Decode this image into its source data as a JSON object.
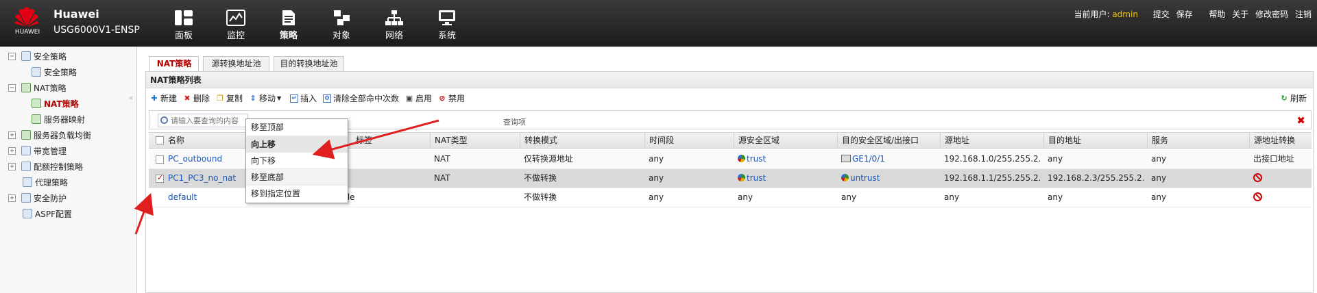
{
  "header": {
    "logo_text": "HUAWEI",
    "brand": "Huawei",
    "model": "USG6000V1-ENSP",
    "nav": [
      {
        "label": "面板",
        "icon": "dashboard-icon"
      },
      {
        "label": "监控",
        "icon": "monitor-icon"
      },
      {
        "label": "策略",
        "icon": "policy-icon"
      },
      {
        "label": "对象",
        "icon": "object-icon"
      },
      {
        "label": "网络",
        "icon": "network-icon"
      },
      {
        "label": "系统",
        "icon": "system-icon"
      }
    ],
    "user_label": "当前用户:",
    "user_name": "admin",
    "actions": [
      "提交",
      "保存",
      "帮助",
      "关于",
      "修改密码",
      "注销"
    ]
  },
  "sidebar": {
    "items": [
      {
        "label": "安全策略",
        "toggle": "−"
      },
      {
        "label": "安全策略"
      },
      {
        "label": "NAT策略",
        "toggle": "−"
      },
      {
        "label": "NAT策略"
      },
      {
        "label": "服务器映射"
      },
      {
        "label": "服务器负载均衡",
        "toggle": "+"
      },
      {
        "label": "带宽管理",
        "toggle": "+"
      },
      {
        "label": "配额控制策略",
        "toggle": "+"
      },
      {
        "label": "代理策略"
      },
      {
        "label": "安全防护",
        "toggle": "+"
      },
      {
        "label": "ASPF配置"
      }
    ],
    "collapse": "«"
  },
  "tabs": [
    "NAT策略",
    "源转换地址池",
    "目的转换地址池"
  ],
  "panel_title": "NAT策略列表",
  "toolbar": {
    "new": "新建",
    "delete": "删除",
    "copy": "复制",
    "move": "移动",
    "insert": "插入",
    "clear_hits": "清除全部命中次数",
    "enable": "启用",
    "disable": "禁用",
    "refresh": "刷新"
  },
  "search": {
    "placeholder": "请输入要查询的内容",
    "query": "查询项"
  },
  "table": {
    "columns": [
      "名称",
      "标签",
      "NAT类型",
      "转换模式",
      "时间段",
      "源安全区域",
      "目的安全区域/出接口",
      "源地址",
      "目的地址",
      "服务",
      "源地址转换"
    ],
    "rows": [
      {
        "name": "PC_outbound",
        "desc": "",
        "nat_type": "NAT",
        "mode": "仅转换源地址",
        "time": "any",
        "src_zone": "trust",
        "dst": "GE1/0/1",
        "src_addr": "192.168.1.0/255.255.2...",
        "dst_addr": "any",
        "service": "any",
        "src_nat": "出接口地址"
      },
      {
        "name": "PC1_PC3_no_nat",
        "desc": "",
        "nat_type": "NAT",
        "mode": "不做转换",
        "time": "any",
        "src_zone": "trust",
        "dst": "untrust",
        "src_addr": "192.168.1.1/255.255.2...",
        "dst_addr": "192.168.2.3/255.255.2...",
        "service": "any",
        "src_nat": ""
      },
      {
        "name": "default",
        "desc": "This is the default rule",
        "nat_type": "",
        "mode": "不做转换",
        "time": "any",
        "src_zone": "any",
        "dst": "any",
        "src_addr": "any",
        "dst_addr": "any",
        "service": "any",
        "src_nat": ""
      }
    ]
  },
  "move_menu": [
    "移至顶部",
    "向上移",
    "向下移",
    "移至底部",
    "移到指定位置"
  ],
  "colors": {
    "accent": "#b00000",
    "link": "#1a55b5",
    "annotation_arrow": "#e02020"
  }
}
